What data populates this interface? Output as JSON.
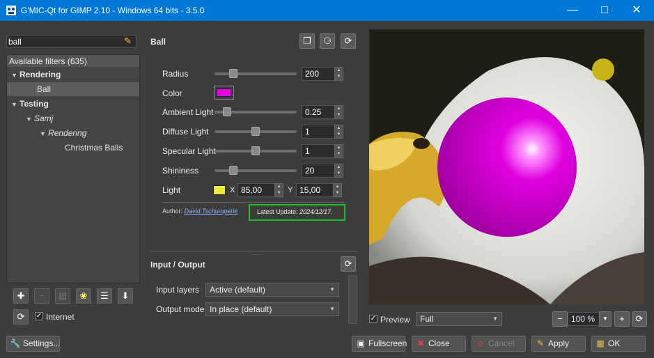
{
  "window": {
    "title": "G'MIC-Qt for GIMP 2.10 - Windows 64 bits - 3.5.0",
    "minimize_icon": "minimize-icon",
    "maximize_icon": "maximize-icon",
    "close_icon": "close-icon"
  },
  "search": {
    "value": "ball",
    "clear_icon": "broom-icon"
  },
  "tree": {
    "header": "Available filters (635)",
    "items": [
      {
        "label": "Rendering",
        "level": 0,
        "expanded": true,
        "bold": true
      },
      {
        "label": "Ball",
        "level": 1,
        "selected": true
      },
      {
        "label": "Testing",
        "level": 0,
        "expanded": true,
        "bold": true
      },
      {
        "label": "Samj",
        "level": 1,
        "expanded": true,
        "italic": true
      },
      {
        "label": "Rendering",
        "level": 2,
        "expanded": true,
        "italic": true
      },
      {
        "label": "Christmas Balls",
        "level": 3
      }
    ]
  },
  "left_tools": {
    "icons": [
      "add-fave-icon",
      "remove-fave-icon",
      "rename-fave-icon",
      "color-wheel-icon",
      "visibility-list-icon",
      "download-icon"
    ],
    "refresh_icon": "refresh-icon",
    "internet_label": "Internet",
    "internet_checked": true
  },
  "filter": {
    "name": "Ball",
    "header_icons": [
      "copy-to-clipboard-icon",
      "randomize-icon",
      "reset-icon"
    ],
    "params": {
      "radius": {
        "label": "Radius",
        "value": "200",
        "slider_fraction": 0.2
      },
      "color": {
        "label": "Color",
        "value": "#e800e8"
      },
      "ambient": {
        "label": "Ambient Light",
        "value": "0.25",
        "slider_fraction": 0.12
      },
      "diffuse": {
        "label": "Diffuse Light",
        "value": "1",
        "slider_fraction": 0.5
      },
      "specular": {
        "label": "Specular Light",
        "value": "1",
        "slider_fraction": 0.5
      },
      "shininess": {
        "label": "Shininess",
        "value": "20",
        "slider_fraction": 0.2
      },
      "light": {
        "label": "Light",
        "color": "#f0e83a",
        "x_label": "X",
        "x_value": "85,00",
        "y_label": "Y",
        "y_value": "15,00"
      }
    },
    "author_prefix": "Author:",
    "author_name": "David Tschumperlé",
    "update_label": "Latest Update:",
    "update_date": "2024/12/17."
  },
  "io": {
    "title": "Input / Output",
    "input_label": "Input layers",
    "input_value": "Active (default)",
    "output_label": "Output mode",
    "output_value": "In place (default)"
  },
  "preview": {
    "checkbox_label": "Preview",
    "checked": true,
    "split_mode": "Full",
    "zoom": "100 %"
  },
  "buttons": {
    "settings": "Settings...",
    "fullscreen": "Fullscreen",
    "close": "Close",
    "cancel": "Cancel",
    "apply": "Apply",
    "ok": "OK"
  },
  "colors": {
    "titlebar": "#0078d7",
    "ball": "#e800e8",
    "highlight_box": "#21c021"
  }
}
